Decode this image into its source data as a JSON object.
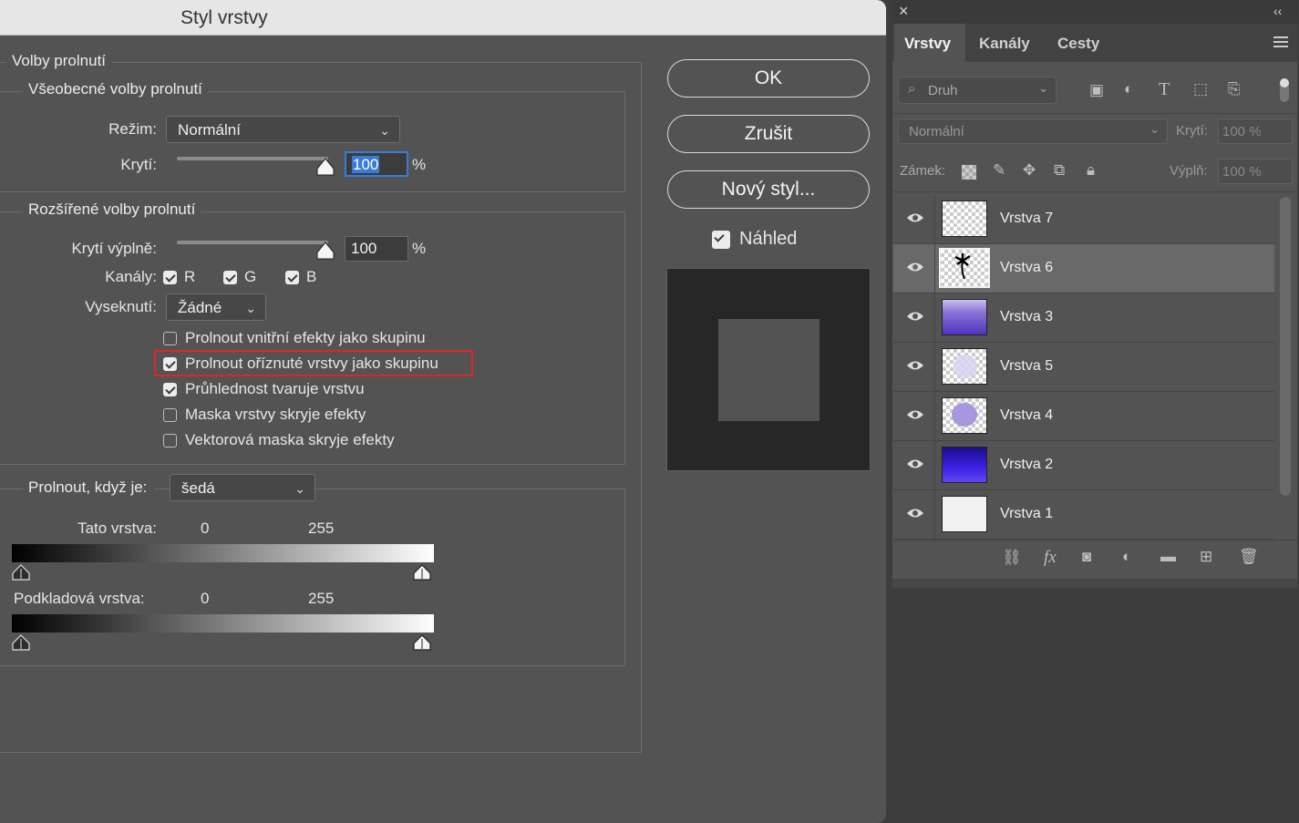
{
  "dialog": {
    "title": "Styl vrstvy",
    "section_blending": "Volby prolnutí",
    "general": {
      "legend": "Všeobecné volby prolnutí",
      "mode_label": "Režim:",
      "mode_value": "Normální",
      "opacity_label": "Krytí:",
      "opacity_value": "100",
      "percent": "%"
    },
    "advanced": {
      "legend": "Rozšířené volby prolnutí",
      "fill_label": "Krytí výplně:",
      "fill_value": "100",
      "percent": "%",
      "channels_label": "Kanály:",
      "channel_r": "R",
      "channel_g": "G",
      "channel_b": "B",
      "knockout_label": "Vyseknutí:",
      "knockout_value": "Žádné",
      "options": [
        {
          "label": "Prolnout vnitřní efekty jako skupinu",
          "checked": false
        },
        {
          "label": "Prolnout oříznuté vrstvy jako skupinu",
          "checked": true,
          "highlighted": true
        },
        {
          "label": "Průhlednost tvaruje vrstvu",
          "checked": true
        },
        {
          "label": "Maska vrstvy skryje efekty",
          "checked": false
        },
        {
          "label": "Vektorová maska skryje efekty",
          "checked": false
        }
      ]
    },
    "blend_if": {
      "label": "Prolnout, když je:",
      "value": "šedá",
      "this_layer_label": "Tato vrstva:",
      "this_layer_min": "0",
      "this_layer_max": "255",
      "underlying_label": "Podkladová vrstva:",
      "underlying_min": "0",
      "underlying_max": "255"
    },
    "buttons": {
      "ok": "OK",
      "cancel": "Zrušit",
      "new_style": "Nový styl..."
    },
    "preview_label": "Náhled",
    "preview_checked": true
  },
  "panel": {
    "close": "×",
    "collapse": "‹‹",
    "tabs": [
      "Vrstvy",
      "Kanály",
      "Cesty"
    ],
    "active_tab": "Vrstvy",
    "filter_placeholder": "Druh",
    "blend_mode": "Normální",
    "opacity_label": "Krytí:",
    "opacity_value": "100 %",
    "lock_label": "Zámek:",
    "fill_label": "Výplň:",
    "fill_value": "100 %",
    "layers": [
      {
        "name": "Vrstva 7",
        "thumb": "transparent",
        "selected": false
      },
      {
        "name": "Vrstva 6",
        "thumb": "palm",
        "selected": true
      },
      {
        "name": "Vrstva 3",
        "thumb": "purple-wave",
        "selected": false
      },
      {
        "name": "Vrstva 5",
        "thumb": "light-blob",
        "selected": false
      },
      {
        "name": "Vrstva 4",
        "thumb": "purple-blob",
        "selected": false
      },
      {
        "name": "Vrstva 2",
        "thumb": "blue-gradient",
        "selected": false
      },
      {
        "name": "Vrstva 1",
        "thumb": "white",
        "selected": false
      }
    ]
  },
  "colors": {
    "highlight": "#e0242b",
    "selection_accent": "#3b7bd8"
  }
}
